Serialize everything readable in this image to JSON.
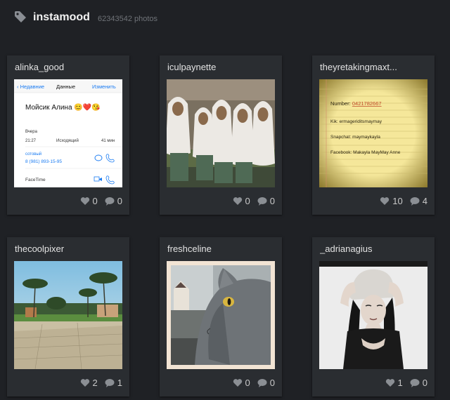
{
  "header": {
    "tag": "instamood",
    "count": "62343542 photos",
    "tag_icon": "tag-icon"
  },
  "photos": [
    {
      "user": "alinka_good",
      "likes": "0",
      "comments": "0",
      "contact": {
        "back": "Недавние",
        "title": "Данные",
        "edit": "Изменить",
        "name": "Мойсик Алина 😊❤️😘",
        "date": "Вчера",
        "time": "21:27",
        "direction": "Исходящий",
        "duration": "41 мин",
        "phone_label": "сотовый",
        "phone": "8 (981) 893-15-95",
        "facetime": "FaceTime"
      }
    },
    {
      "user": "iculpaynette",
      "likes": "0",
      "comments": "0"
    },
    {
      "user": "theyretakingmaxt...",
      "likes": "10",
      "comments": "4",
      "note": {
        "number_label": "Number:",
        "number": "0421782667",
        "kik": "Kik: ermageriditsmaymay",
        "snapchat": "Snapchat: maymaykayla",
        "facebook": "Facebook: Makayla MayMay Anne"
      }
    },
    {
      "user": "thecoolpixer",
      "likes": "2",
      "comments": "1"
    },
    {
      "user": "freshceline",
      "likes": "0",
      "comments": "0"
    },
    {
      "user": "_adrianagius",
      "likes": "1",
      "comments": "0"
    }
  ],
  "icons": {
    "like": "heart-icon",
    "comment": "comment-bubble-icon"
  },
  "colors": {
    "background": "#1f2125",
    "card": "#2a2d31",
    "link_blue": "#1a7bf2"
  }
}
